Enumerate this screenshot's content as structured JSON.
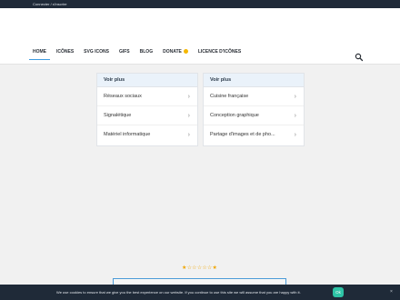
{
  "topbar": {
    "login_text": "Connecter / s'inscrire"
  },
  "nav": {
    "items": [
      {
        "label": "HOME"
      },
      {
        "label": "ICÔNES"
      },
      {
        "label": "SVG ICONS"
      },
      {
        "label": "GIFS"
      },
      {
        "label": "BLOG"
      },
      {
        "label": "DONATE"
      },
      {
        "label": "LICENCE D'ICÔNES"
      }
    ],
    "active_color": "#3d9be0"
  },
  "cards": [
    {
      "title": "Voir plus",
      "rows": [
        "Réseaux sociaux",
        "Signalétique",
        "Matériel informatique"
      ]
    },
    {
      "title": "Voir plus",
      "rows": [
        "Cuisine française",
        "Conception graphique",
        "Partage d'images et de pho..."
      ]
    }
  ],
  "rating": {
    "stars": "★☆☆☆☆☆★"
  },
  "cookie": {
    "message": "We use cookies to ensure that we give you the best experience on our website. If you continue to use this site we will assume that you are happy with it.",
    "ok_label": "Ok",
    "close_label": "×",
    "ok_color": "#2ec4a6"
  }
}
